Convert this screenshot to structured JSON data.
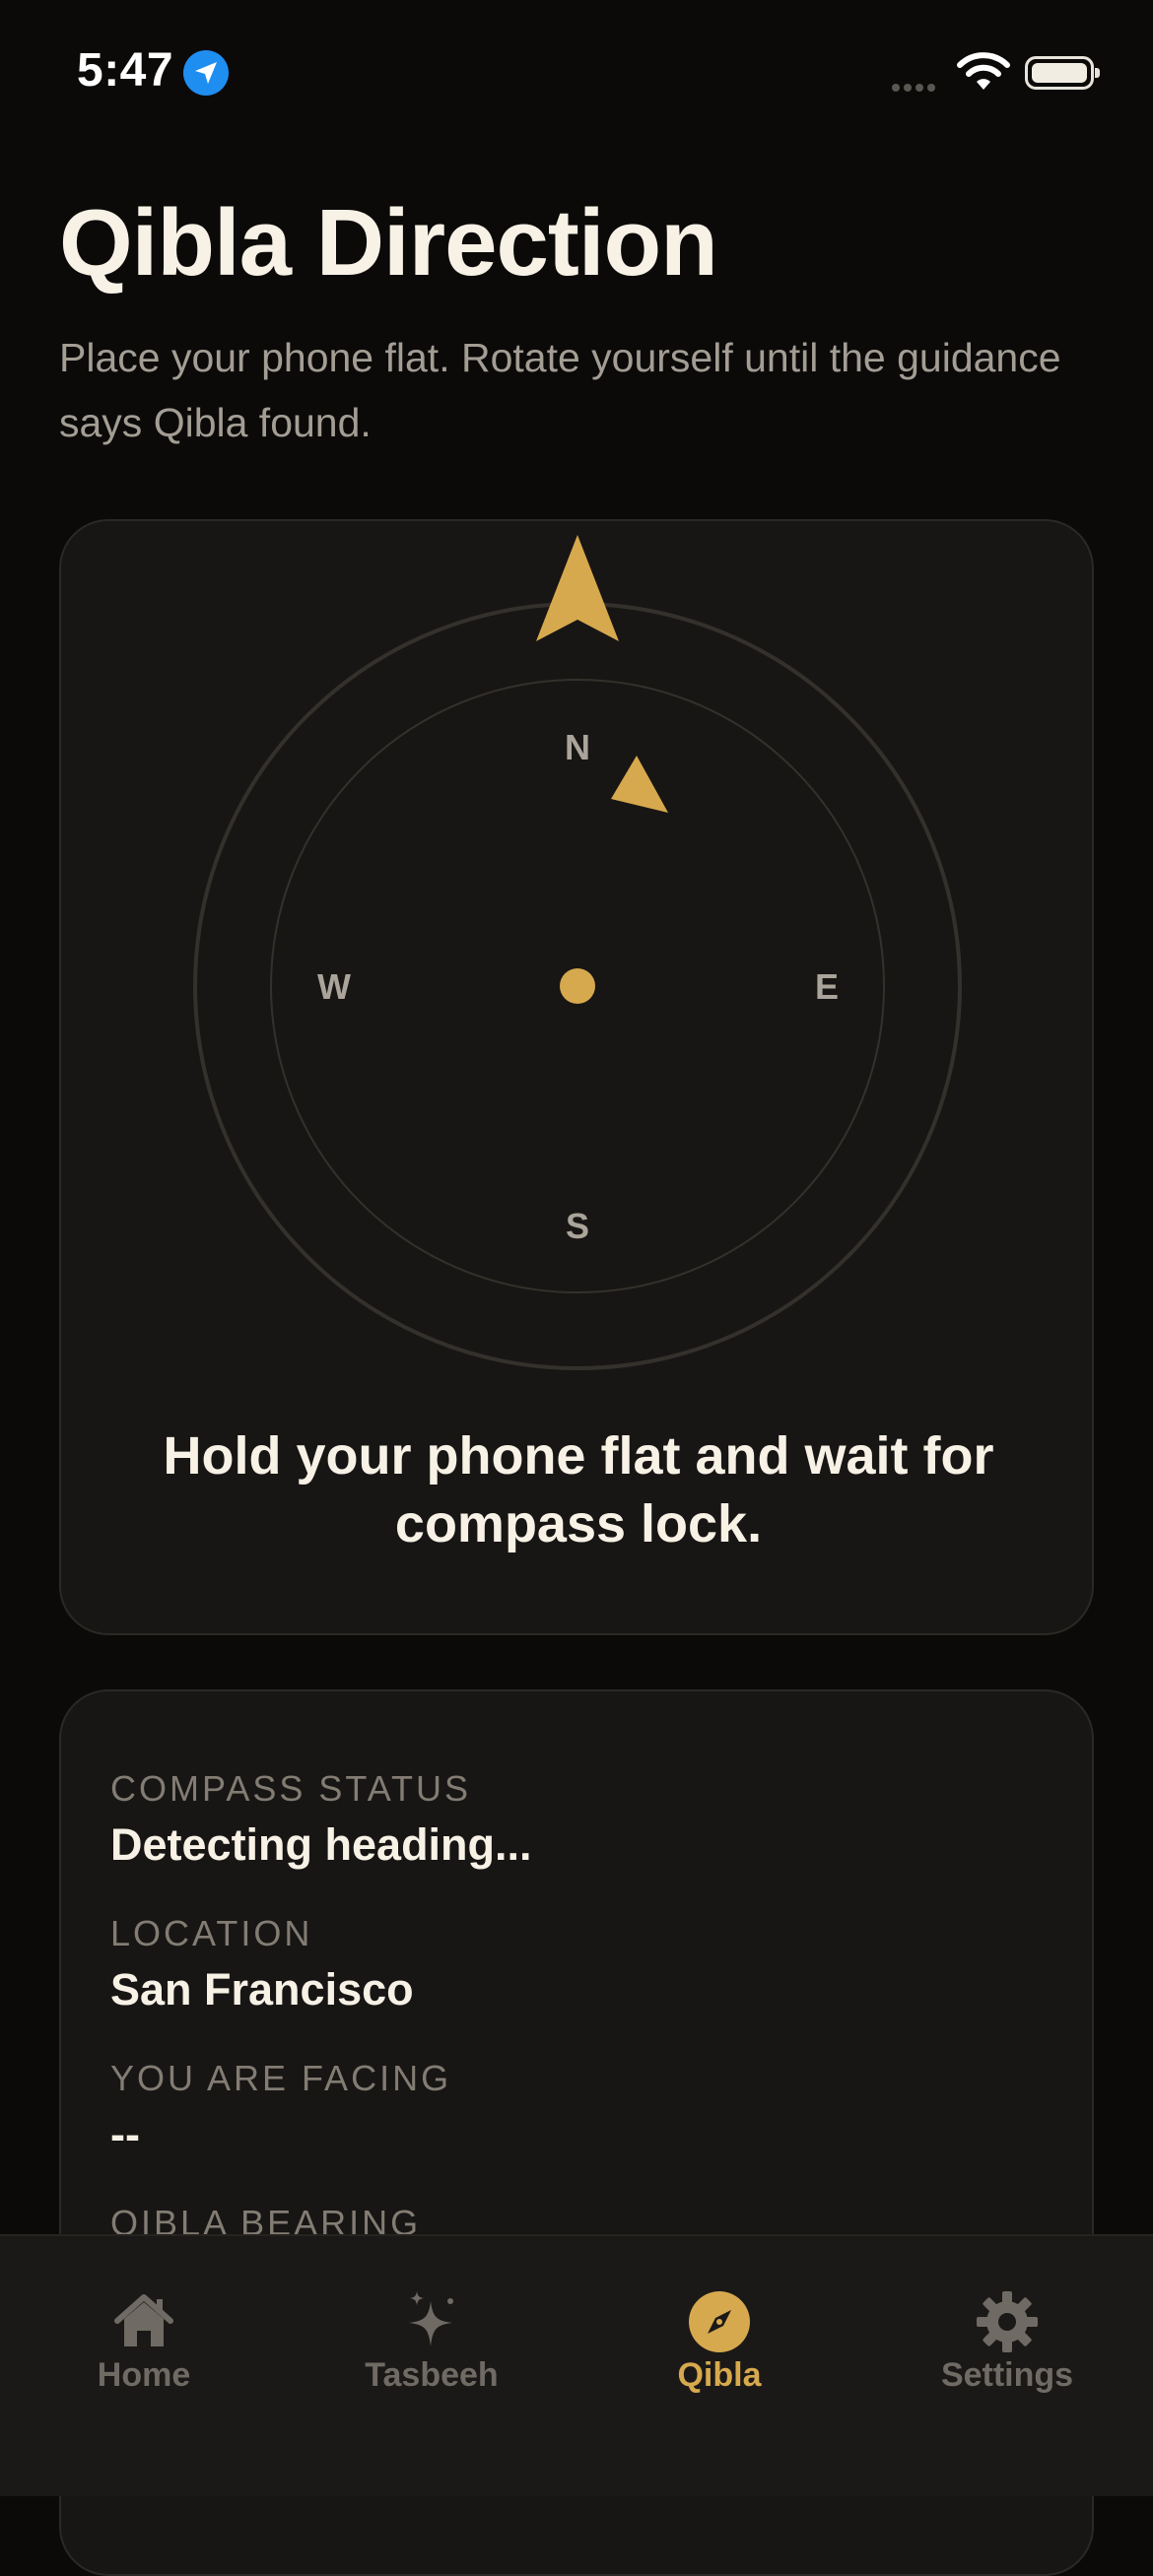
{
  "status_bar": {
    "time": "5:47"
  },
  "header": {
    "title": "Qibla Direction",
    "subtitle": "Place your phone flat. Rotate yourself until the guidance says Qibla found."
  },
  "compass": {
    "cardinal": {
      "north": "N",
      "south": "S",
      "east": "E",
      "west": "W"
    },
    "guidance": "Hold your phone flat and wait for compass lock.",
    "accent_color": "#d7a94e"
  },
  "info": {
    "compass_status_label": "COMPASS STATUS",
    "compass_status_value": "Detecting heading...",
    "location_label": "LOCATION",
    "location_value": "San Francisco",
    "facing_label": "YOU ARE FACING",
    "facing_value": "--",
    "qibla_bearing_label": "QIBLA BEARING"
  },
  "tabs": [
    {
      "label": "Home",
      "icon": "home-icon",
      "active": false
    },
    {
      "label": "Tasbeeh",
      "icon": "sparkle-icon",
      "active": false
    },
    {
      "label": "Qibla",
      "icon": "compass-icon",
      "active": true
    },
    {
      "label": "Settings",
      "icon": "gear-icon",
      "active": false
    }
  ]
}
